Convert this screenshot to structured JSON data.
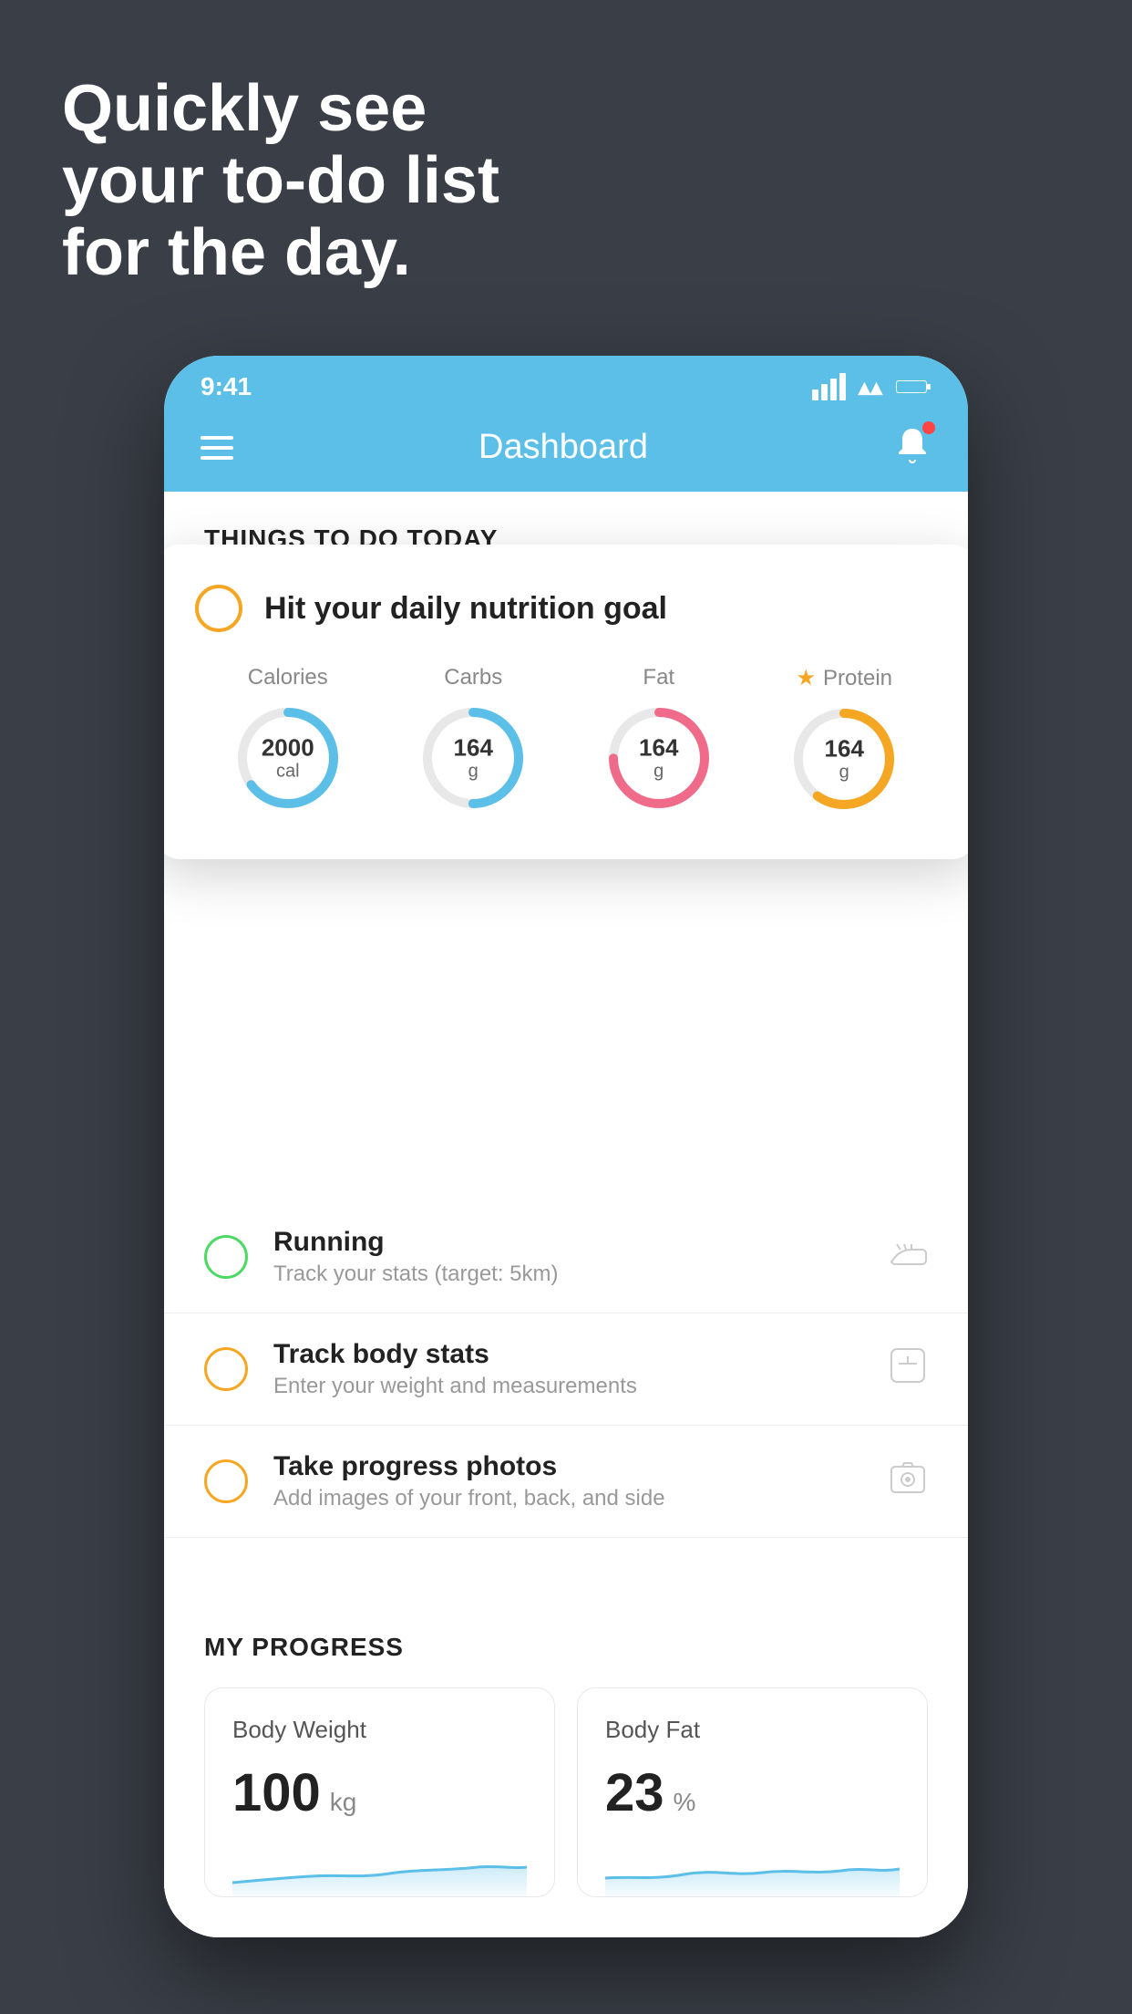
{
  "hero": {
    "line1": "Quickly see",
    "line2": "your to-do list",
    "line3": "for the day."
  },
  "status_bar": {
    "time": "9:41"
  },
  "nav": {
    "title": "Dashboard"
  },
  "things_today": {
    "header": "THINGS TO DO TODAY"
  },
  "floating_card": {
    "title": "Hit your daily nutrition goal",
    "nutrition": [
      {
        "label": "Calories",
        "value": "2000",
        "unit": "cal",
        "color": "#5bbfe8",
        "percent": 65,
        "starred": false
      },
      {
        "label": "Carbs",
        "value": "164",
        "unit": "g",
        "color": "#5bbfe8",
        "percent": 50,
        "starred": false
      },
      {
        "label": "Fat",
        "value": "164",
        "unit": "g",
        "color": "#f06b8a",
        "percent": 75,
        "starred": false
      },
      {
        "label": "Protein",
        "value": "164",
        "unit": "g",
        "color": "#f5a623",
        "percent": 60,
        "starred": true
      }
    ]
  },
  "todo_items": [
    {
      "title": "Running",
      "subtitle": "Track your stats (target: 5km)",
      "circle_color": "green",
      "icon": "shoe"
    },
    {
      "title": "Track body stats",
      "subtitle": "Enter your weight and measurements",
      "circle_color": "yellow",
      "icon": "scale"
    },
    {
      "title": "Take progress photos",
      "subtitle": "Add images of your front, back, and side",
      "circle_color": "yellow",
      "icon": "photo"
    }
  ],
  "progress": {
    "header": "MY PROGRESS",
    "cards": [
      {
        "title": "Body Weight",
        "value": "100",
        "unit": "kg"
      },
      {
        "title": "Body Fat",
        "value": "23",
        "unit": "%"
      }
    ]
  },
  "colors": {
    "background": "#3a3f47",
    "phone_bg": "#f2f2f2",
    "nav_blue": "#5bbfe8",
    "accent_yellow": "#f5a623",
    "accent_green": "#4cd964",
    "accent_red": "#ff4444"
  }
}
